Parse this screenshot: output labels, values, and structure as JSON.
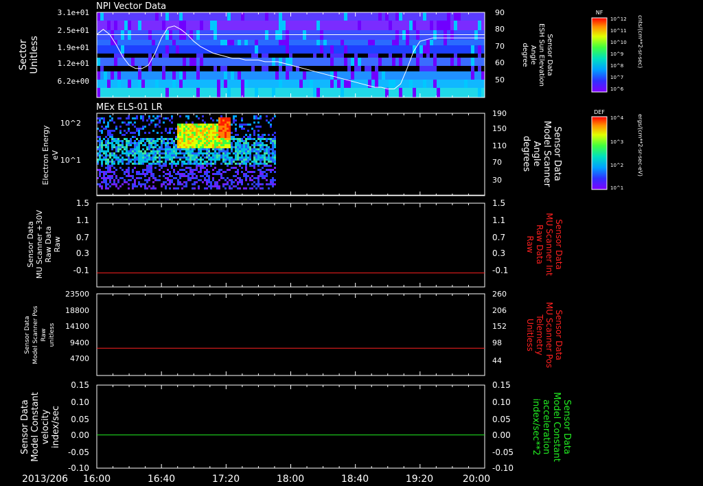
{
  "date_label": "2013/206",
  "time_ticks": [
    "16:00",
    "16:40",
    "17:20",
    "18:00",
    "18:40",
    "19:20",
    "20:00"
  ],
  "colors": {
    "red": "#ff2020",
    "green": "#22ee22",
    "white": "#ffffff"
  },
  "chart_data": [
    {
      "type": "heatmap",
      "title": "NPI Vector Data",
      "ylabel_lines": [
        "Sector",
        "Unitless"
      ],
      "yticks_left": [
        "3.1e+01",
        "2.5e+01",
        "1.9e+01",
        "1.2e+01",
        "6.2e+00"
      ],
      "yticks_right": [
        "90",
        "80",
        "70",
        "60",
        "50"
      ],
      "right_label_lines": [
        "Sensor Data",
        "ESH Sun Elevation",
        "Angle",
        "degree"
      ],
      "colorbar": {
        "label": "NF",
        "ticks": [
          "10^12",
          "10^11",
          "10^10",
          "10^9",
          "10^8",
          "10^7",
          "10^6"
        ],
        "units": "cnts/(cm**2-sr-sec)"
      },
      "overlay_line": {
        "name": "ESH Sun Elevation Angle",
        "ylim": [
          40,
          90
        ],
        "x": [
          0,
          4,
          8,
          12,
          16,
          20,
          24,
          28,
          32,
          36,
          40,
          44,
          48,
          52,
          56,
          60,
          64,
          68,
          72,
          76,
          80,
          84,
          88,
          92,
          96,
          100,
          104,
          108,
          112,
          116,
          120,
          124,
          128,
          132,
          136,
          140,
          144,
          148,
          152,
          156,
          160,
          164,
          168,
          172,
          176,
          180,
          184,
          188,
          192,
          196,
          200,
          204,
          208,
          210,
          212,
          216,
          220,
          224,
          228,
          232,
          236,
          240
        ],
        "values": [
          77,
          80,
          77,
          71,
          64,
          59,
          57,
          57,
          59,
          66,
          75,
          81,
          82,
          80,
          77,
          73,
          70,
          68,
          66,
          65,
          64,
          63,
          63,
          62,
          62,
          62,
          61,
          61,
          61,
          60,
          59,
          58,
          57,
          56,
          55,
          54,
          53,
          52,
          51,
          50,
          49,
          48,
          47,
          46,
          46,
          45,
          45,
          48,
          57,
          67,
          73,
          74,
          75,
          75,
          75,
          75,
          75,
          75,
          75,
          75,
          75,
          75
        ]
      }
    },
    {
      "type": "heatmap",
      "title": "MEx ELS-01 LR",
      "ylabel_lines": [
        "Electron Energy",
        "eV"
      ],
      "yticks_left": [
        "10^2",
        "10^1"
      ],
      "yticks_right": [
        "190",
        "150",
        "110",
        "70",
        "30"
      ],
      "right_label_lines": [
        "Sensor Data",
        "Model Scanner",
        "Angle",
        "degrees"
      ],
      "colorbar": {
        "label": "DEF",
        "ticks": [
          "10^4",
          "10^3",
          "10^2",
          "10^1"
        ],
        "units": "ergs/(cm**2-sr-sec-eV)"
      },
      "overlay_line": {
        "name": "Model Scanner Angle",
        "ylim": [
          10,
          190
        ],
        "x": [
          0,
          240
        ],
        "values": [
          11,
          11
        ]
      }
    },
    {
      "type": "line",
      "title": "",
      "ylabel_lines": [
        "Sensor Data",
        "MU Scanner +30V",
        "Raw Data",
        "Raw"
      ],
      "yticks_left": [
        "1.5",
        "1.1",
        "0.7",
        "0.3",
        "-0.1"
      ],
      "yticks_right": [
        "1.5",
        "1.1",
        "0.7",
        "0.3",
        "-0.1"
      ],
      "right_label_lines": [
        "Sensor Data",
        "MU Scanner Int",
        "Raw Data",
        "Raw"
      ],
      "ylim": [
        -0.3,
        1.5
      ],
      "series": [
        {
          "x": [
            0,
            240
          ],
          "values": [
            0.0,
            0.0
          ]
        }
      ]
    },
    {
      "type": "line",
      "title": "",
      "ylabel_lines": [
        "Sensor Data",
        "Model Scanner Pos",
        "Raw",
        "unitless"
      ],
      "yticks_left": [
        "23500",
        "18800",
        "14100",
        "9400",
        "4700"
      ],
      "yticks_right": [
        "260",
        "206",
        "152",
        "98",
        "44"
      ],
      "right_label_lines": [
        "Sensor Data",
        "MU Scanner Pos",
        "Telemetry",
        "Unitless"
      ],
      "ylim": [
        0,
        23500
      ],
      "series": [
        {
          "x": [
            0,
            240
          ],
          "values": [
            7850,
            7850
          ]
        }
      ]
    },
    {
      "type": "line",
      "title": "",
      "ylabel_lines": [
        "Sensor Data",
        "Model Constant",
        "velocity",
        "index/sec"
      ],
      "yticks_left": [
        "0.15",
        "0.10",
        "0.05",
        "0.00",
        "-0.05",
        "-0.10"
      ],
      "yticks_right": [
        "0.15",
        "0.10",
        "0.05",
        "0.00",
        "-0.05",
        "-0.10"
      ],
      "right_label_lines": [
        "Sensor Data",
        "Model Constant",
        "acceleration",
        "index/sec**2"
      ],
      "ylim": [
        -0.1,
        0.15
      ],
      "series": [
        {
          "x": [
            0,
            240
          ],
          "values": [
            0.0,
            0.0
          ]
        }
      ]
    }
  ]
}
